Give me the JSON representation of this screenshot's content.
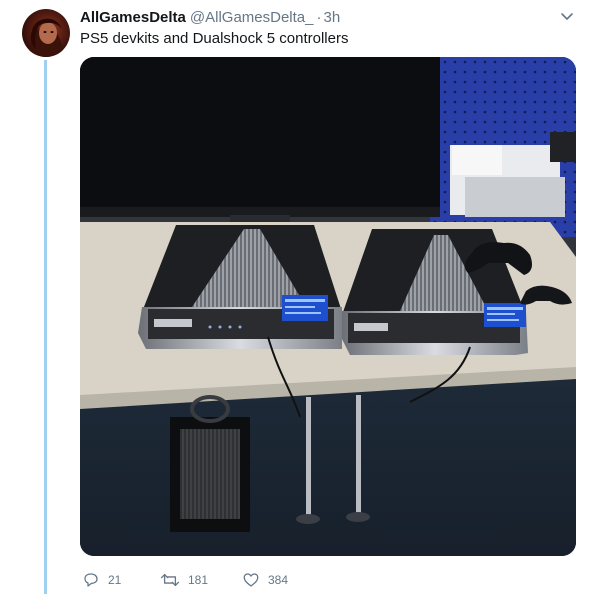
{
  "tweet": {
    "author_name": "AllGamesDelta",
    "author_handle": "@AllGamesDelta_",
    "separator": "·",
    "time": "3h",
    "text": "PS5 devkits and Dualshock 5 controllers",
    "avatar_icon": "user-avatar",
    "media_icon": "tweet-photo"
  },
  "actions": {
    "reply_count": "21",
    "retweet_count": "181",
    "like_count": "384"
  },
  "colors": {
    "text": "#14171a",
    "muted": "#657786",
    "thread_line": "#9fd0f0"
  }
}
